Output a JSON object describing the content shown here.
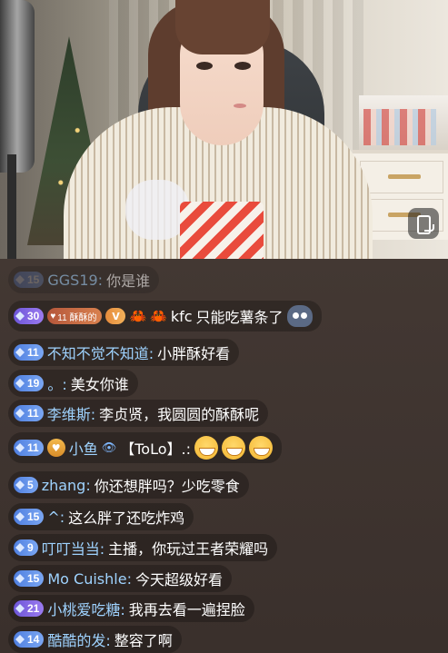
{
  "chat": {
    "messages": [
      {
        "level": "15",
        "user": "GGS19:",
        "text": "你是谁",
        "faded": true
      },
      {
        "level": "30",
        "fan_badge": "11 酥酥的",
        "v_badge": "V",
        "user": "kfc",
        "text": "只能吃薯条了"
      },
      {
        "level": "11",
        "user": "不知不觉不知道:",
        "text": "小胖酥好看"
      },
      {
        "level": "19",
        "user": "。:",
        "text": "美女你谁"
      },
      {
        "level": "11",
        "user": "李维斯:",
        "text": "李贞贤，我圆圆的酥酥呢"
      },
      {
        "level": "11",
        "user": "小鱼",
        "tag": "【ToLo】.:"
      },
      {
        "level": "5",
        "user": "zhang:",
        "text": "你还想胖吗？少吃零食"
      },
      {
        "level": "15",
        "user": "^:",
        "text": "这么胖了还吃炸鸡"
      },
      {
        "level": "9",
        "user": "叮叮当当:",
        "text": "主播，你玩过王者荣耀吗"
      },
      {
        "level": "15",
        "user": "Mo Cuishle:",
        "text": "今天超级好看"
      },
      {
        "level": "21",
        "user": "小桃爱吃糖:",
        "text": "我再去看一遍捏脸"
      },
      {
        "level": "14",
        "user": "酷酷的发:",
        "text": "整容了啊"
      }
    ]
  },
  "icons": {
    "screen_rotate": "phone-rotate-icon",
    "level_gem": "diamond-icon",
    "crab": "crab-emoji",
    "grin": "grinning-face-emoji"
  },
  "colors": {
    "username": "#9fd3ff",
    "level_badge": "#5b8ce6",
    "chat_bg": "#3b302c"
  }
}
